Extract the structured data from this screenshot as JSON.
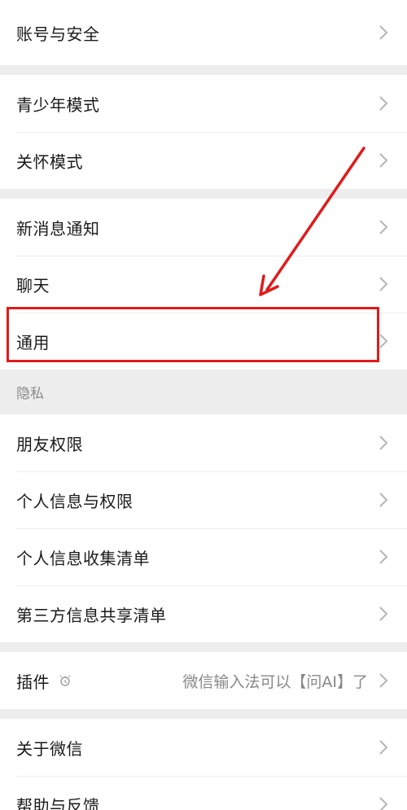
{
  "settings": {
    "account_security": "账号与安全",
    "teen_mode": "青少年模式",
    "care_mode": "关怀模式",
    "new_message_notify": "新消息通知",
    "chat": "聊天",
    "general": "通用",
    "privacy_header": "隐私",
    "friend_permissions": "朋友权限",
    "personal_info_permissions": "个人信息与权限",
    "personal_info_collection": "个人信息收集清单",
    "third_party_share": "第三方信息共享清单",
    "plugins": "插件",
    "plugins_value": "微信输入法可以【问AI】了",
    "about_wechat": "关于微信",
    "help_feedback": "帮助与反馈"
  },
  "icons": {
    "chevron": "chevron-right-icon",
    "plugin_badge": "bell-icon"
  },
  "colors": {
    "annotation": "#e01b1b",
    "background": "#ededed",
    "row": "#ffffff"
  }
}
